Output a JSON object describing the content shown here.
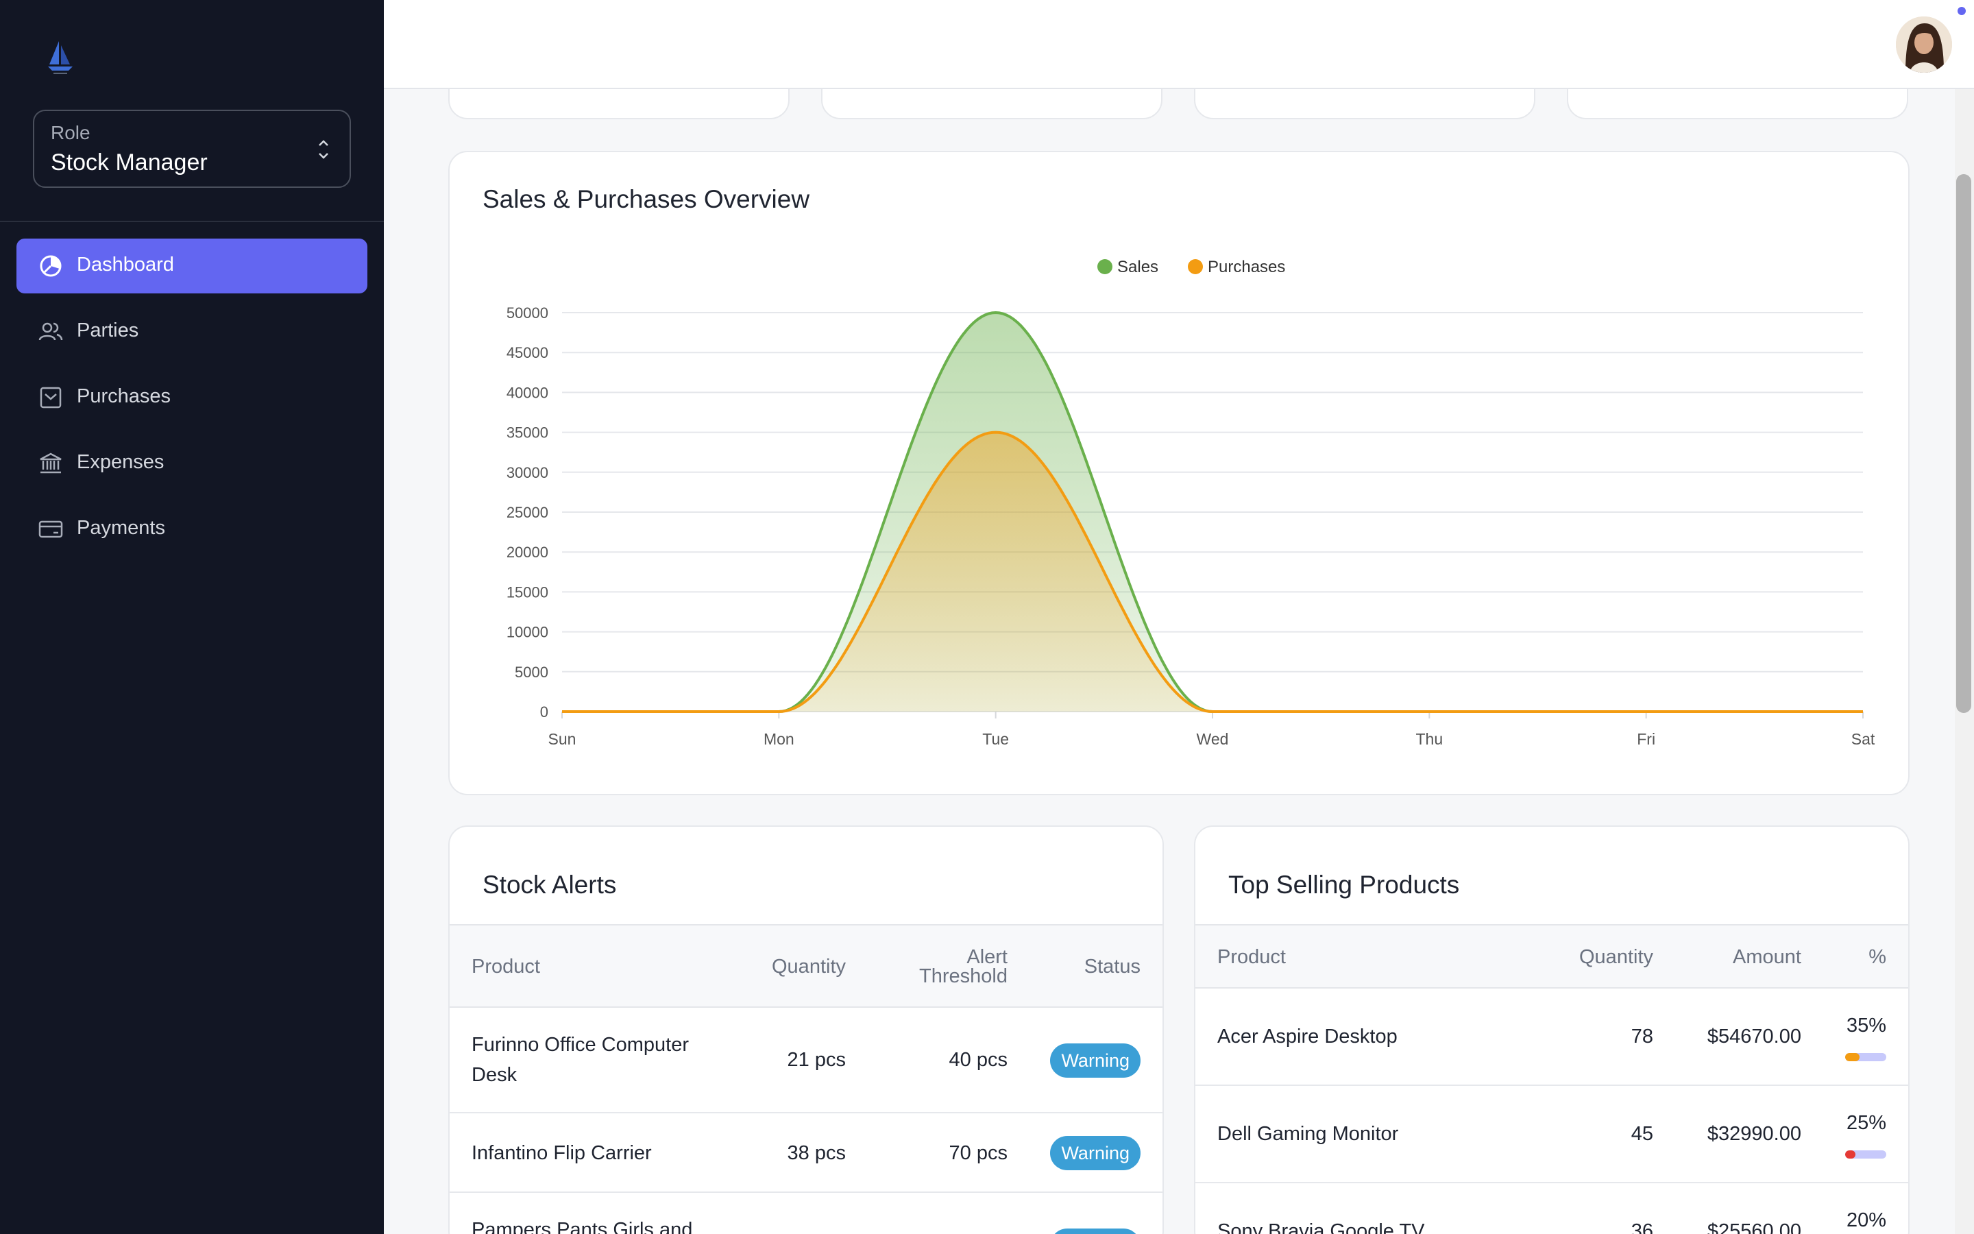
{
  "sidebar": {
    "role_label": "Role",
    "role_value": "Stock Manager",
    "nav": [
      {
        "label": "Dashboard",
        "icon": "pie-chart-icon",
        "active": true
      },
      {
        "label": "Parties",
        "icon": "users-icon",
        "active": false
      },
      {
        "label": "Purchases",
        "icon": "inbox-icon",
        "active": false
      },
      {
        "label": "Expenses",
        "icon": "bank-icon",
        "active": false
      },
      {
        "label": "Payments",
        "icon": "credit-card-icon",
        "active": false
      }
    ]
  },
  "colors": {
    "sidebar_bg": "#121624",
    "accent": "#6366f1",
    "sales": "#6ab04c",
    "purchases": "#f39c12",
    "badge_warning": "#3b9fd6"
  },
  "chart": {
    "title": "Sales & Purchases Overview"
  },
  "chart_data": {
    "type": "area",
    "title": "Sales & Purchases Overview",
    "categories": [
      "Sun",
      "Mon",
      "Tue",
      "Wed",
      "Thu",
      "Fri",
      "Sat"
    ],
    "series": [
      {
        "name": "Sales",
        "color": "#6ab04c",
        "values": [
          0,
          0,
          50000,
          0,
          0,
          0,
          0
        ]
      },
      {
        "name": "Purchases",
        "color": "#f39c12",
        "values": [
          0,
          0,
          35000,
          0,
          0,
          0,
          0
        ]
      }
    ],
    "y_ticks": [
      "0",
      "5000",
      "10000",
      "15000",
      "20000",
      "25000",
      "30000",
      "35000",
      "40000",
      "45000",
      "50000"
    ],
    "ylim": [
      0,
      50000
    ],
    "legend": "top",
    "grid": true
  },
  "stock_alerts": {
    "title": "Stock Alerts",
    "headers": {
      "product": "Product",
      "quantity": "Quantity",
      "alert_1": "Alert",
      "alert_2": "Threshold",
      "status": "Status"
    },
    "rows": [
      {
        "product_1": "Furinno Office Computer",
        "product_2": "Desk",
        "quantity": "21 pcs",
        "threshold": "40 pcs",
        "status": "Warning"
      },
      {
        "product_1": "Infantino Flip Carrier",
        "product_2": "",
        "quantity": "38 pcs",
        "threshold": "70 pcs",
        "status": "Warning"
      },
      {
        "product_1": "Pampers Pants Girls and",
        "product_2": "",
        "quantity": "",
        "threshold": "",
        "status": ""
      }
    ]
  },
  "top_selling": {
    "title": "Top Selling Products",
    "headers": {
      "product": "Product",
      "quantity": "Quantity",
      "amount": "Amount",
      "percent": "%"
    },
    "rows": [
      {
        "product": "Acer Aspire Desktop",
        "quantity": "78",
        "amount": "$54670.00",
        "percent": "35%",
        "fraction": 0.35,
        "fill_color": "#f39c12"
      },
      {
        "product": "Dell Gaming Monitor",
        "quantity": "45",
        "amount": "$32990.00",
        "percent": "25%",
        "fraction": 0.25,
        "fill_color": "#e53935"
      },
      {
        "product": "Sony Bravia Google TV",
        "quantity": "36",
        "amount": "$25560.00",
        "percent": "20%",
        "fraction": 0.2,
        "fill_color": "#6366f1"
      }
    ]
  }
}
